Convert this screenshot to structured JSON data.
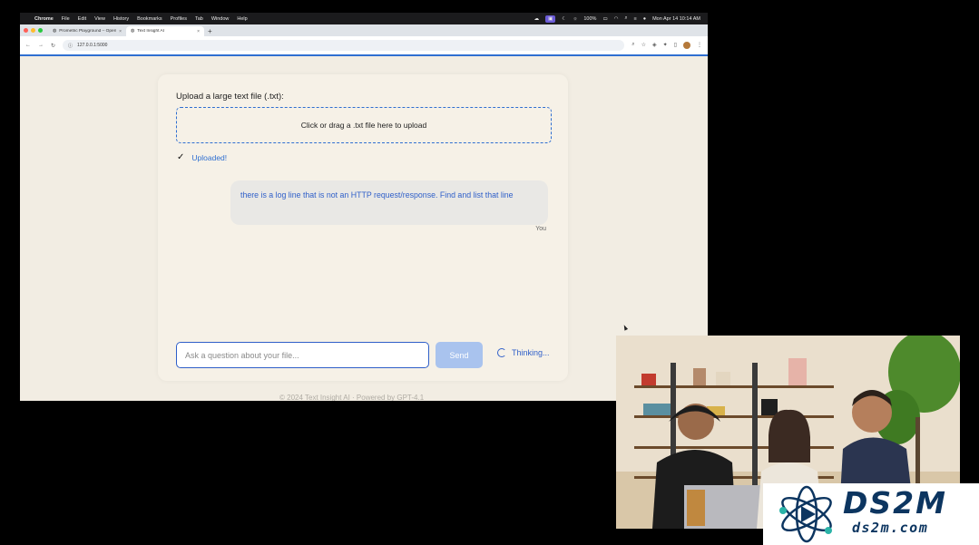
{
  "menubar": {
    "app": "Chrome",
    "items": [
      "File",
      "Edit",
      "View",
      "History",
      "Bookmarks",
      "Profiles",
      "Tab",
      "Window",
      "Help"
    ],
    "battery": "100%",
    "clock": "Mon Apr 14  10:14 AM"
  },
  "browser": {
    "tabs": [
      {
        "title": "Prometric Playground – OpenAI"
      },
      {
        "title": "Text Insight AI"
      }
    ],
    "url": "127.0.0.1:5000",
    "accent_color": "#2f6fd1"
  },
  "app": {
    "upload_label": "Upload a large text file (.txt):",
    "dropzone_text": "Click or drag a .txt file here to upload",
    "uploaded_text": "Uploaded!",
    "message": {
      "text": "there is a log line that is not an HTTP request/response. Find and list that line",
      "sender": "You"
    },
    "input_placeholder": "Ask a question about your file...",
    "send_label": "Send",
    "status_text": "Thinking...",
    "footer": "© 2024 Text Insight AI · Powered by GPT-4.1"
  },
  "watermark": {
    "brand": "DS2M",
    "site": "ds2m.com"
  }
}
